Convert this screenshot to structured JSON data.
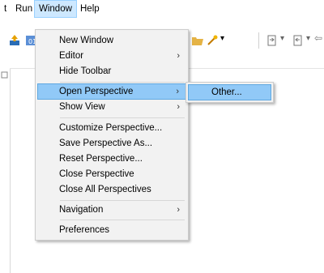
{
  "menubar": {
    "items": [
      {
        "label": "t"
      },
      {
        "label": "Run"
      },
      {
        "label": "Window"
      },
      {
        "label": "Help"
      }
    ]
  },
  "window_menu": {
    "items": [
      {
        "label": "New Window"
      },
      {
        "label": "Editor",
        "submenu_arrow": "›"
      },
      {
        "label": "Hide Toolbar"
      },
      {
        "label": "Open Perspective",
        "submenu_arrow": "›"
      },
      {
        "label": "Show View",
        "submenu_arrow": "›"
      },
      {
        "label": "Customize Perspective..."
      },
      {
        "label": "Save Perspective As..."
      },
      {
        "label": "Reset Perspective..."
      },
      {
        "label": "Close Perspective"
      },
      {
        "label": "Close All Perspectives"
      },
      {
        "label": "Navigation",
        "submenu_arrow": "›"
      },
      {
        "label": "Preferences"
      }
    ]
  },
  "perspective_submenu": {
    "items": [
      {
        "label": "Other..."
      }
    ]
  },
  "toolbar": {
    "icons": [
      "export-icon",
      "java-class-icon",
      "open-folder-icon",
      "run-tool-icon",
      "next-annotation-icon",
      "prev-annotation-icon",
      "back-arrow-icon",
      "forward-arrow-icon"
    ],
    "dropdown_glyph": "▾",
    "nav_back_glyph": "⇦",
    "nav_fwd_glyph": "⇨"
  },
  "colors": {
    "menu_bg": "#f2f2f2",
    "highlight": "#91c9f7",
    "menubar_active": "#cde8ff"
  }
}
